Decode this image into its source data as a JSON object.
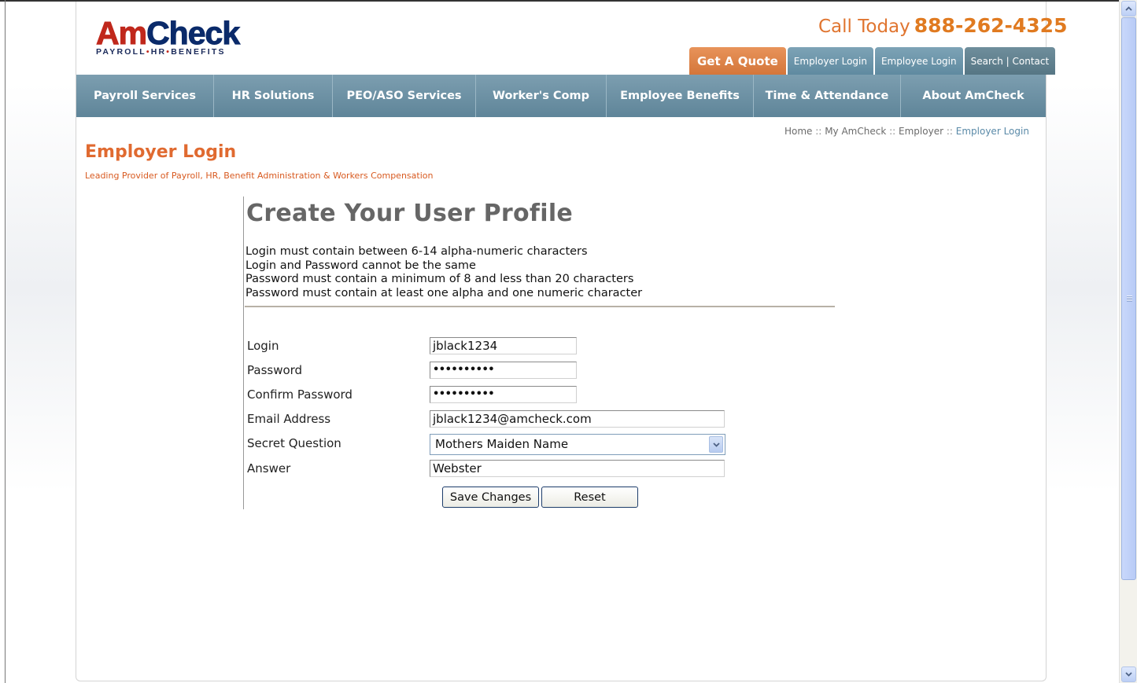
{
  "brand": {
    "logo_am": "Am",
    "logo_check": "Check",
    "tagline_parts": [
      "PAYROLL",
      "HR",
      "BENEFITS"
    ],
    "dot": "•",
    "accent_orange": "#e07530",
    "nav_blue": "#6a8fa3"
  },
  "phone": {
    "prefix": "Call Today",
    "number": "888-262-4325"
  },
  "top_tabs": {
    "quote": "Get A Quote",
    "employer_login": "Employer Login",
    "employee_login": "Employee Login",
    "search_contact": "Search | Contact"
  },
  "nav": {
    "items": [
      "Payroll Services",
      "HR Solutions",
      "PEO/ASO Services",
      "Worker's Comp",
      "Employee Benefits",
      "Time & Attendance",
      "About AmCheck"
    ]
  },
  "breadcrumb": {
    "items": [
      "Home",
      "My AmCheck",
      "Employer",
      "Employer Login"
    ],
    "separator": "::"
  },
  "page": {
    "title": "Employer Login",
    "subtitle": "Leading Provider of Payroll, HR, Benefit Administration & Workers Compensation"
  },
  "form": {
    "heading": "Create Your User Profile",
    "rules": [
      "Login must contain between 6-14 alpha-numeric characters",
      "Login and Password cannot be the same",
      "Password must contain a minimum of 8 and less than 20 characters",
      "Password must contain at least one alpha and one numeric character"
    ],
    "login": {
      "label": "Login",
      "value": "jblack1234"
    },
    "password": {
      "label": "Password",
      "value": "••••••••••"
    },
    "confirm_password": {
      "label": "Confirm Password",
      "value": "••••••••••"
    },
    "email": {
      "label": "Email Address",
      "value": "jblack1234@amcheck.com"
    },
    "secret_question": {
      "label": "Secret Question",
      "value": "Mothers Maiden Name"
    },
    "answer": {
      "label": "Answer",
      "value": "Webster"
    },
    "save_label": "Save Changes",
    "reset_label": "Reset"
  },
  "icons": {
    "dropdown": "chevron-down-icon",
    "scroll_up": "arrow-up-icon",
    "scroll_down": "arrow-down-icon"
  }
}
